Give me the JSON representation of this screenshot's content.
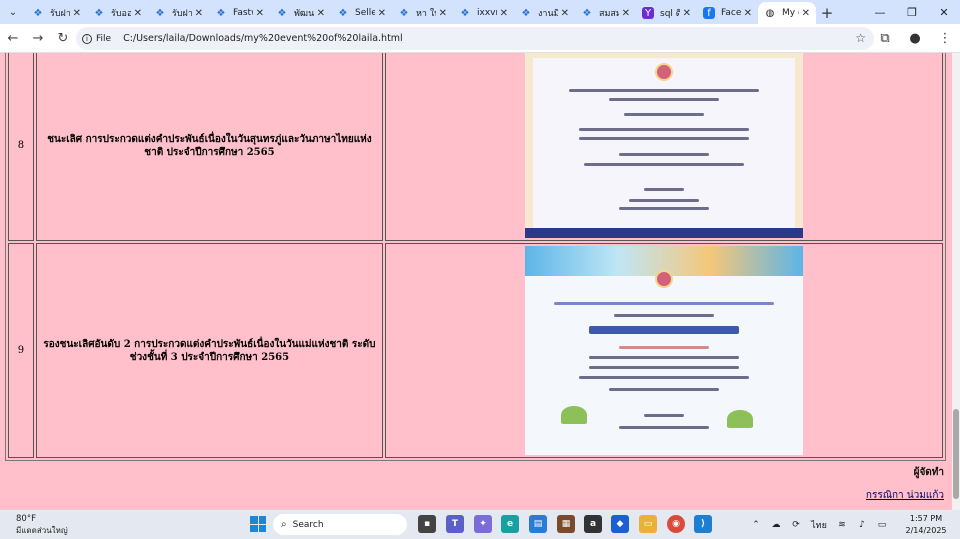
{
  "tabs": [
    {
      "title": "รับฝาก",
      "icon": "butterfly-icon"
    },
    {
      "title": "รับออก",
      "icon": "butterfly-icon"
    },
    {
      "title": "รับฝาก",
      "icon": "butterfly-icon"
    },
    {
      "title": "Fastw",
      "icon": "butterfly-icon"
    },
    {
      "title": "พัฒนา",
      "icon": "butterfly-icon"
    },
    {
      "title": "Selle",
      "icon": "butterfly-icon"
    },
    {
      "title": "หา ใบ",
      "icon": "butterfly-icon"
    },
    {
      "title": "ixxvm",
      "icon": "butterfly-icon"
    },
    {
      "title": "งานมี",
      "icon": "butterfly-icon"
    },
    {
      "title": "สมสม",
      "icon": "butterfly-icon"
    },
    {
      "title": "sql ดี",
      "icon": "yahoo-icon"
    },
    {
      "title": "Face",
      "icon": "facebook-icon"
    }
  ],
  "active_tab": {
    "title": "My e",
    "icon": "globe-icon"
  },
  "address": {
    "scheme_label": "File",
    "url": "C:/Users/laila/Downloads/my%20event%20of%20laila.html"
  },
  "rows": [
    {
      "num": "8",
      "desc": "ชนะเลิศ การประกวดแต่งคำประพันธ์เนื่องในวันสุนทรภู่และวันภาษาไทยแห่งชาติ ประจำปีการศึกษา 2565",
      "image_alt": "certificate photo 8"
    },
    {
      "num": "9",
      "desc": "รองชนะเลิศอันดับ 2 การประกวดแต่งคำประพันธ์เนื่องในวันแม่แห่งชาติ ระดับช่วงชั้นที่ 3 ประจำปีการศึกษา 2565",
      "image_alt": "certificate photo 9"
    }
  ],
  "footer": {
    "organizer_label": "ผู้จัดทำ",
    "organizer_name": "กรรณิกา น่วมแก้ว"
  },
  "taskbar": {
    "weather_temp": "80°F",
    "weather_desc": "มีแดดส่วนใหญ่",
    "search_placeholder": "Search",
    "lang": "ไทย",
    "time": "1:57 PM",
    "date": "2/14/2025"
  },
  "colors": {
    "page_bg": "#ffc0cb",
    "tabstrip_bg": "#d3e3fd",
    "link": "#00006b"
  }
}
